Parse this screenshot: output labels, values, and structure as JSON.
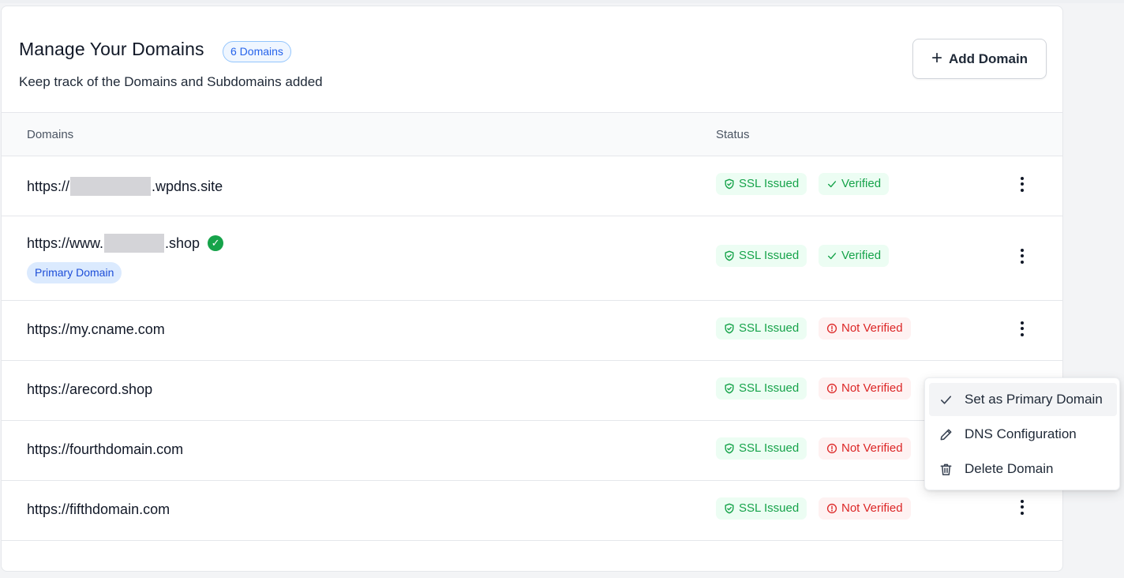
{
  "header": {
    "title": "Manage Your Domains",
    "count_badge": "6 Domains",
    "subtitle": "Keep track of the Domains and Subdomains added",
    "add_button_label": "Add Domain"
  },
  "table": {
    "columns": [
      "Domains",
      "Status"
    ],
    "rows": [
      {
        "domain_prefix": "https://",
        "domain_suffix": ".wpdns.site",
        "redacted": true,
        "ssl": "SSL Issued",
        "verification": "Verified",
        "verified": true,
        "primary": false
      },
      {
        "domain_prefix": "https://www.",
        "domain_suffix": ".shop",
        "redacted": true,
        "ssl": "SSL Issued",
        "verification": "Verified",
        "verified": true,
        "primary": true,
        "primary_label": "Primary Domain"
      },
      {
        "domain_prefix": "https://my.cname.com",
        "domain_suffix": "",
        "redacted": false,
        "ssl": "SSL Issued",
        "verification": "Not Verified",
        "verified": false,
        "primary": false
      },
      {
        "domain_prefix": "https://arecord.shop",
        "domain_suffix": "",
        "redacted": false,
        "ssl": "SSL Issued",
        "verification": "Not Verified",
        "verified": false,
        "primary": false
      },
      {
        "domain_prefix": "https://fourthdomain.com",
        "domain_suffix": "",
        "redacted": false,
        "ssl": "SSL Issued",
        "verification": "Not Verified",
        "verified": false,
        "primary": false
      },
      {
        "domain_prefix": "https://fifthdomain.com",
        "domain_suffix": "",
        "redacted": false,
        "ssl": "SSL Issued",
        "verification": "Not Verified",
        "verified": false,
        "primary": false
      }
    ]
  },
  "context_menu": {
    "items": [
      {
        "label": "Set as Primary Domain",
        "icon": "check-icon"
      },
      {
        "label": "DNS Configuration",
        "icon": "pencil-icon"
      },
      {
        "label": "Delete Domain",
        "icon": "trash-icon"
      }
    ]
  },
  "colors": {
    "success": "#16a34a",
    "danger": "#dc2626",
    "accent": "#2563eb"
  }
}
